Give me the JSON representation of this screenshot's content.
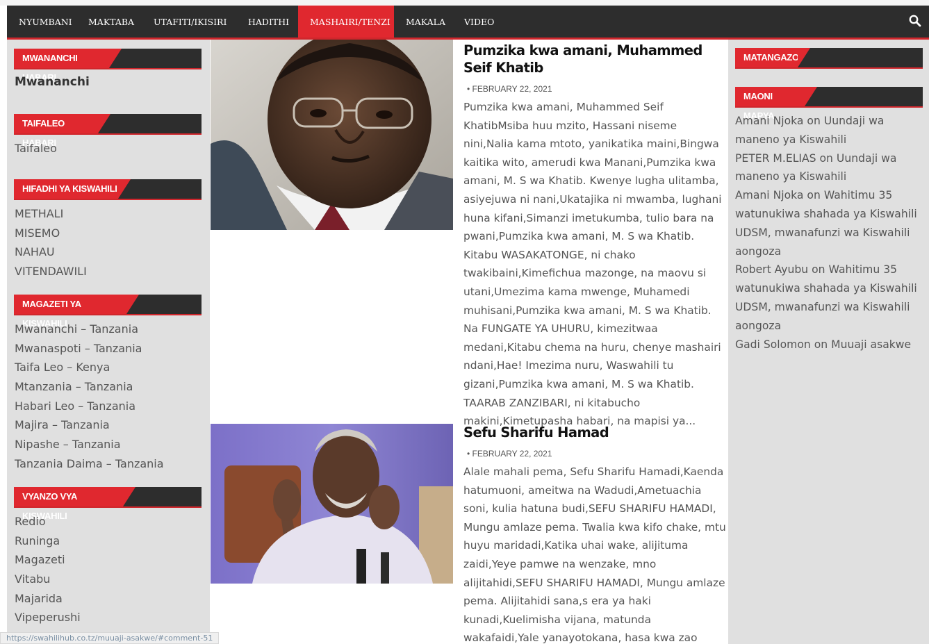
{
  "nav": {
    "items": [
      "NYUMBANI",
      "MAKTABA",
      "UTAFITI/IKISIRI",
      "HADITHI",
      "MASHAIRI/TENZI",
      "MAKALA",
      "VIDEO"
    ],
    "active": "MASHAIRI/TENZI"
  },
  "left": {
    "mwananchi": {
      "title": "MWANANCHI HABARI",
      "text": "Mwananchi"
    },
    "taifaleo": {
      "title": "TAIFALEO HABARI",
      "text": "Taifaleo"
    },
    "hifadhi": {
      "title": "HIFADHI YA KISWAHILI",
      "items": [
        "METHALI",
        "MISEMO",
        "NAHAU",
        "VITENDAWILI"
      ]
    },
    "magazeti": {
      "title": "MAGAZETI YA KISWAHILI",
      "items": [
        "Mwananchi – Tanzania",
        "Mwanaspoti – Tanzania",
        "Taifa Leo – Kenya",
        "Mtanzania – Tanzania",
        "Habari Leo – Tanzania",
        "Majira – Tanzania",
        "Nipashe – Tanzania",
        "Tanzania Daima – Tanzania"
      ]
    },
    "vyanzo": {
      "title": "VYANZO VYA KISWAHILI",
      "items": [
        "Redio",
        "Runinga",
        "Magazeti",
        "Vitabu",
        "Majarida",
        "Vipeperushi"
      ]
    }
  },
  "posts": [
    {
      "title": "Pumzika kwa amani, Muhammed Seif Khatib",
      "date": "FEBRUARY 22, 2021",
      "excerpt": "Pumzika kwa amani, Muhammed Seif KhatibMsiba huu mzito, Hassani niseme nini,Nalia kama mtoto, yanikatika maini,Bingwa kaitika wito, amerudi kwa Manani,Pumzika kwa amani, M. S wa Khatib. Kwenye lugha ulitamba, asiyejuwa ni nani,Ukatajika ni mwamba, lughani huna kifani,Simanzi imetukumba, tulio bara na pwani,Pumzika kwa amani, M. S wa Khatib. Kitabu WASAKATONGE, ni chako twakibaini,Kimefichua mazonge, na maovu si utani,Umezima kama mwenge, Muhamedi muhisani,Pumzika kwa amani, M. S wa Khatib. Na FUNGATE YA UHURU, kimezitwaa medani,Kitabu chema na huru, chenye mashairi ndani,Hae! Imezima nuru, Waswahili tu gizani,Pumzika kwa amani, M. S wa Khatib. TAARAB ZANZIBARI, ni kitabucho makini,Kimetupasha habari, na mapisi ya..."
    },
    {
      "title": "Sefu Sharifu Hamad",
      "date": "FEBRUARY 22, 2021",
      "excerpt": "Alale mahali pema, Sefu Sharifu Hamadi,Kaenda hatumuoni, ameitwa na Wadudi,Ametuachia soni, kulia hatuna budi,SEFU SHARIFU HAMADI, Mungu amlaze pema. Twalia kwa kifo chake, mtu huyu maridadi,Katika uhai wake, alijituma zaidi,Yeye pamwe na wenzake, mno alijitahidi,SEFU SHARIFU HAMADI, Mungu amlaze pema. Alijitahidi sana,s era ya haki kunadi,Kuelimisha vijana, matunda wakafaidi,Yale yanayotokana, hasa kwa zao juhudi,SEFU SHARIFU HAMADI,"
    }
  ],
  "right": {
    "ads_title": "MATANGAZO",
    "comments_title": "MAONI MAPYA",
    "on_word": "on",
    "comments": [
      {
        "author": "Amani Njoka",
        "post": "Uundaji wa maneno ya Kiswahili"
      },
      {
        "author": "PETER M.ELIAS",
        "post": "Uundaji wa maneno ya Kiswahili"
      },
      {
        "author": "Amani Njoka",
        "post": "Wahitimu 35 watunukiwa shahada ya Kiswahili UDSM, mwanafunzi wa Kiswahili aongoza"
      },
      {
        "author": "Robert Ayubu",
        "post": "Wahitimu 35 watunukiwa shahada ya Kiswahili UDSM, mwanafunzi wa Kiswahili aongoza"
      },
      {
        "author": "Gadi Solomon",
        "post": "Muuaji asakwe"
      }
    ]
  },
  "status_url": "https://swahilihub.co.tz/muuaji-asakwe/#comment-51",
  "colors": {
    "nav_bg": "#2d2d2d",
    "accent": "#e0282f",
    "sidebar_bg": "#e0e0e0"
  },
  "icons": {
    "search": "search-icon"
  }
}
